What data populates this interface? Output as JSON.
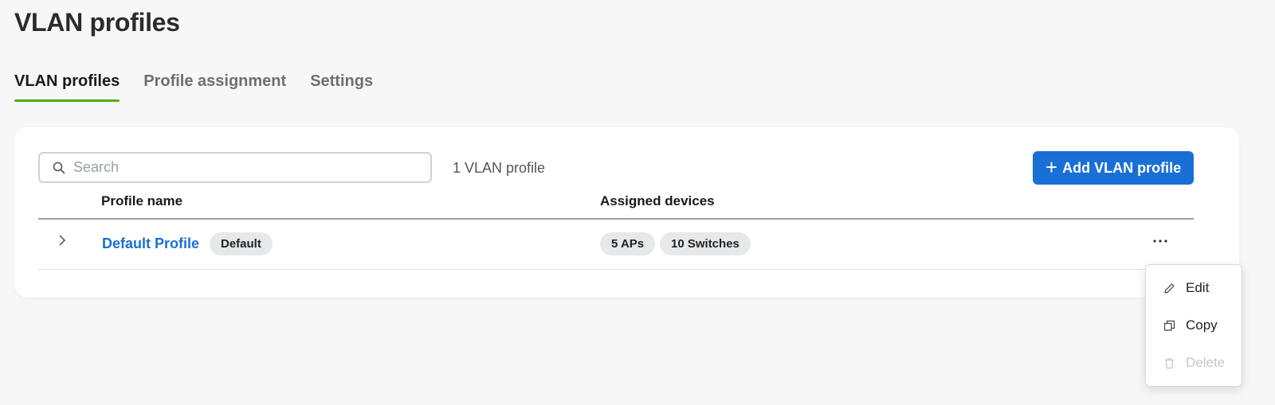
{
  "page": {
    "title": "VLAN profiles"
  },
  "tabs": [
    {
      "label": "VLAN profiles",
      "active": true
    },
    {
      "label": "Profile assignment",
      "active": false
    },
    {
      "label": "Settings",
      "active": false
    }
  ],
  "toolbar": {
    "search_placeholder": "Search",
    "count_text": "1 VLAN profile",
    "add_button_label": "Add VLAN profile"
  },
  "table": {
    "columns": [
      "Profile name",
      "Assigned devices"
    ],
    "rows": [
      {
        "name": "Default Profile",
        "badge": "Default",
        "devices": [
          "5 APs",
          "10 Switches"
        ]
      }
    ]
  },
  "row_menu": {
    "items": [
      {
        "label": "Edit",
        "icon": "pencil-icon",
        "enabled": true
      },
      {
        "label": "Copy",
        "icon": "copy-icon",
        "enabled": true
      },
      {
        "label": "Delete",
        "icon": "trash-icon",
        "enabled": false
      }
    ]
  },
  "colors": {
    "accent": "#1a6fd6",
    "tab_underline": "#4caf1a",
    "background": "#f7f7f7"
  }
}
